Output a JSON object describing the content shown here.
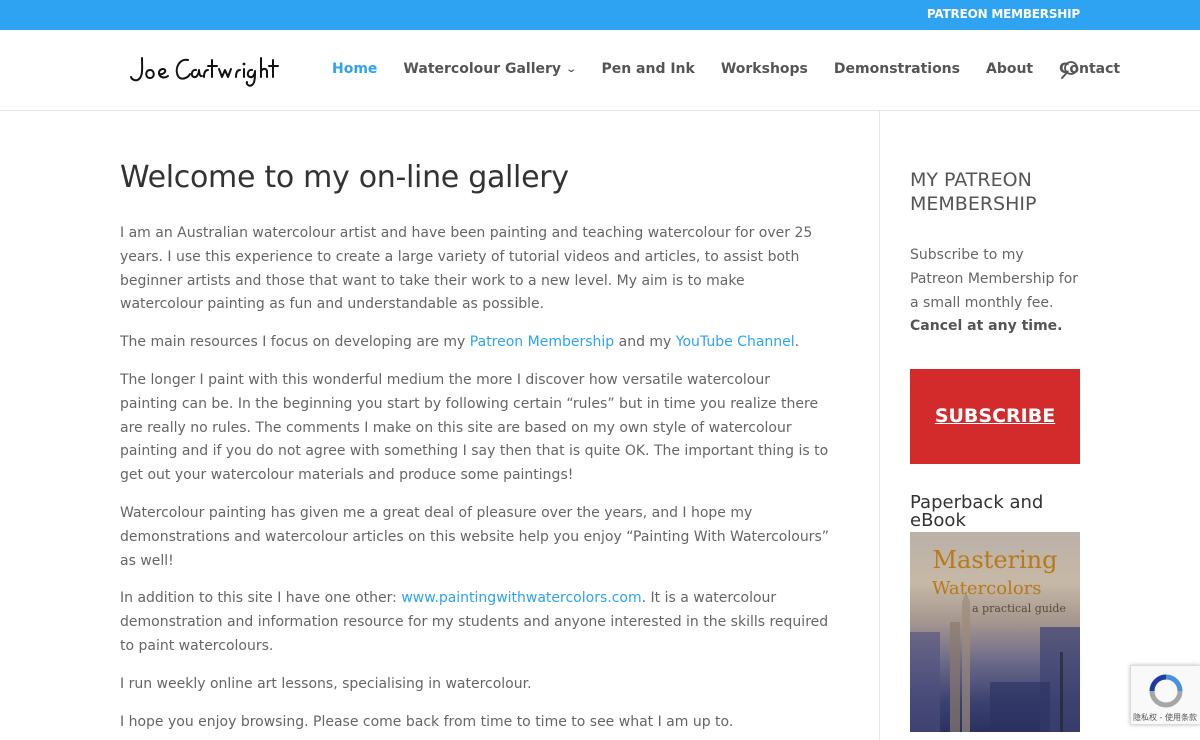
{
  "topbar": {
    "link": "PATREON MEMBERSHIP"
  },
  "logo": {
    "text": "Joe Cartwright"
  },
  "nav": {
    "items": [
      "Home",
      "Watercolour Gallery",
      "Pen and Ink",
      "Workshops",
      "Demonstrations",
      "About",
      "Contact"
    ],
    "active": "Home"
  },
  "main": {
    "title": "Welcome to my on-line gallery",
    "p1": "I am an Australian watercolour artist and have been painting and teaching watercolour for over 25 years. I use this experience to create a large variety of tutorial videos and articles, to assist both beginner artists and those that want to take their work to a new level. My aim is to make watercolour painting as fun and understandable as possible.",
    "p2_a": "The main resources I focus on developing are my ",
    "p2_link1": "Patreon Membership",
    "p2_b": " and my ",
    "p2_link2": "YouTube Channel",
    "p2_c": ".",
    "p3": "The longer I paint with this wonderful medium the more I discover how versatile watercolour painting can be. In the beginning you start by following certain “rules” but in time you realize there are really no rules. The comments I make on this site are based on my own style of watercolour painting and if you do not agree with something I say then that is quite OK. The important thing is to get out your watercolour materials and produce some paintings!",
    "p4": "Watercolour painting has given me a great deal of pleasure over the years, and I hope my demonstrations and watercolour articles on this website help you enjoy “Painting With Watercolours” as well!",
    "p5_a": "In addition to this site I have one other: ",
    "p5_link": "www.paintingwithwatercolors.com",
    "p5_b": ". It is a watercolour demonstration and information resource for my students and anyone interested in the skills required to paint watercolours.",
    "p6": "I run weekly online art lessons, specialising in watercolour.",
    "p7": "I hope you enjoy browsing. Please come back from time to time to see what I am up to."
  },
  "sidebar": {
    "title": "MY PATREON MEMBERSHIP",
    "text_a": "Subscribe to my Patreon Membership for a small monthly fee. ",
    "text_bold": "Cancel at any time.",
    "button": "SUBSCRIBE",
    "book_heading": "Paperback and eBook",
    "book_title": "Mastering",
    "book_title2": "Watercolors",
    "book_subtitle": "a practical guide"
  },
  "recaptcha": {
    "text": "隐私权 - 使用条款"
  },
  "colors": {
    "accent": "#2ea3f2",
    "subscribe": "#d32b2b"
  }
}
